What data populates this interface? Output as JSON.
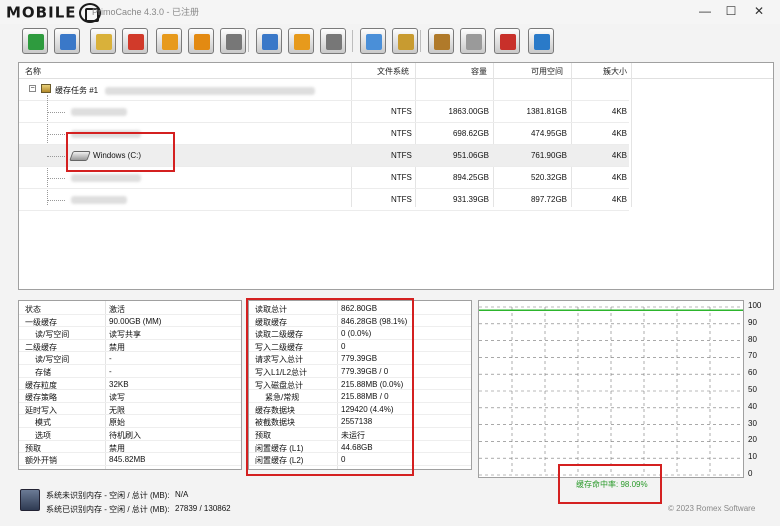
{
  "titlebar": {
    "logo": "MOBILE",
    "app_title": "PrimoCache 4.3.0 - 已注册"
  },
  "window_buttons": {
    "minimize": "—",
    "maximize": "☐",
    "close": "✕"
  },
  "toolbar": {
    "buttons": [
      {
        "icon": "create-cache-icon",
        "color": "#2e9b3e"
      },
      {
        "icon": "cache-settings-icon",
        "color": "#3a78c8"
      },
      {
        "icon": "inspect-cache-icon",
        "color": "#d9b13a"
      },
      {
        "icon": "delete-cache-icon",
        "color": "#d13a2a"
      },
      {
        "icon": "pause-cache-icon",
        "color": "#e79a1c"
      },
      {
        "icon": "flush-cache-icon",
        "color": "#e38a12"
      },
      {
        "icon": "resume-cache-icon",
        "color": "#777777"
      },
      {
        "icon": "add-volume-icon",
        "color": "#3a78c8"
      },
      {
        "icon": "pause-volume-icon",
        "color": "#e79a1c"
      },
      {
        "icon": "resume-volume-icon",
        "color": "#777777"
      },
      {
        "icon": "tools-icon",
        "color": "#4a8fd8"
      },
      {
        "icon": "book-icon",
        "color": "#c89b30"
      },
      {
        "icon": "settings-icon",
        "color": "#b07a2a"
      },
      {
        "icon": "license-icon",
        "color": "#9a9a9a"
      },
      {
        "icon": "help-icon",
        "color": "#c8302a"
      },
      {
        "icon": "about-icon",
        "color": "#2a7ac8"
      }
    ]
  },
  "volume_table": {
    "headers": {
      "name": "名称",
      "fs": "文件系统",
      "capacity": "容量",
      "free": "可用空间",
      "cluster": "簇大小"
    },
    "group_label": "缓存任务 #1",
    "rows": [
      {
        "name": "",
        "fs": "NTFS",
        "capacity": "1863.00GB",
        "free": "1381.81GB",
        "cluster": "4KB"
      },
      {
        "name": "",
        "fs": "NTFS",
        "capacity": "698.62GB",
        "free": "474.95GB",
        "cluster": "4KB"
      },
      {
        "name": "Windows (C:)",
        "fs": "NTFS",
        "capacity": "951.06GB",
        "free": "761.90GB",
        "cluster": "4KB"
      },
      {
        "name": "",
        "fs": "NTFS",
        "capacity": "894.25GB",
        "free": "520.32GB",
        "cluster": "4KB"
      },
      {
        "name": "",
        "fs": "NTFS",
        "capacity": "931.39GB",
        "free": "897.72GB",
        "cluster": "4KB"
      }
    ]
  },
  "config_panel": [
    {
      "k": "状态",
      "v": "激活",
      "indent": 0
    },
    {
      "k": "一级缓存",
      "v": "90.00GB (MM)",
      "indent": 0
    },
    {
      "k": "读/写空间",
      "v": "读写共享",
      "indent": 1
    },
    {
      "k": "二级缓存",
      "v": "禁用",
      "indent": 0
    },
    {
      "k": "读/写空间",
      "v": "-",
      "indent": 1
    },
    {
      "k": "存储",
      "v": "-",
      "indent": 1
    },
    {
      "k": "缓存粒度",
      "v": "32KB",
      "indent": 0
    },
    {
      "k": "缓存策略",
      "v": "读写",
      "indent": 0
    },
    {
      "k": "延时写入",
      "v": "无限",
      "indent": 0
    },
    {
      "k": "模式",
      "v": "原始",
      "indent": 1
    },
    {
      "k": "选项",
      "v": "待机刷入",
      "indent": 1
    },
    {
      "k": "预取",
      "v": "禁用",
      "indent": 0
    },
    {
      "k": "额外开销",
      "v": "845.82MB",
      "indent": 0
    }
  ],
  "stats_panel": [
    {
      "k": "读取总计",
      "v": "862.80GB",
      "indent": 0
    },
    {
      "k": "缓取缓存",
      "v": "846.28GB (98.1%)",
      "indent": 0
    },
    {
      "k": "读取二级缓存",
      "v": "0 (0.0%)",
      "indent": 0
    },
    {
      "k": "写入二级缓存",
      "v": "0",
      "indent": 0
    },
    {
      "k": "请求写入总计",
      "v": "779.39GB",
      "indent": 0
    },
    {
      "k": "写入L1/L2总计",
      "v": "779.39GB / 0",
      "indent": 0
    },
    {
      "k": "写入磁盘总计",
      "v": "215.88MB (0.0%)",
      "indent": 0
    },
    {
      "k": "紧急/常规",
      "v": "215.88MB / 0",
      "indent": 1
    },
    {
      "k": "缓存数据块",
      "v": "129420 (4.4%)",
      "indent": 0
    },
    {
      "k": "被截数据块",
      "v": "2557138",
      "indent": 0
    },
    {
      "k": "预取",
      "v": "未运行",
      "indent": 0
    },
    {
      "k": "闲置缓存 (L1)",
      "v": "44.68GB",
      "indent": 0
    },
    {
      "k": "闲置缓存 (L2)",
      "v": "0",
      "indent": 0
    }
  ],
  "hit_chart": {
    "yticks": [
      "100",
      "90",
      "80",
      "70",
      "60",
      "50",
      "40",
      "30",
      "20",
      "10",
      "0"
    ],
    "hit_rate_label": "缓存命中率: 98.09%",
    "hit_rate": 98.09,
    "line_color": "#2db52d"
  },
  "footer": {
    "unrecognized_label": "系统未识别内存 - 空闲 / 总计 (MB):",
    "unrecognized_value": "N/A",
    "recognized_label": "系统已识别内存 - 空闲 / 总计 (MB):",
    "recognized_value": "27839 / 130862",
    "copyright": "© 2023 Romex Software"
  }
}
